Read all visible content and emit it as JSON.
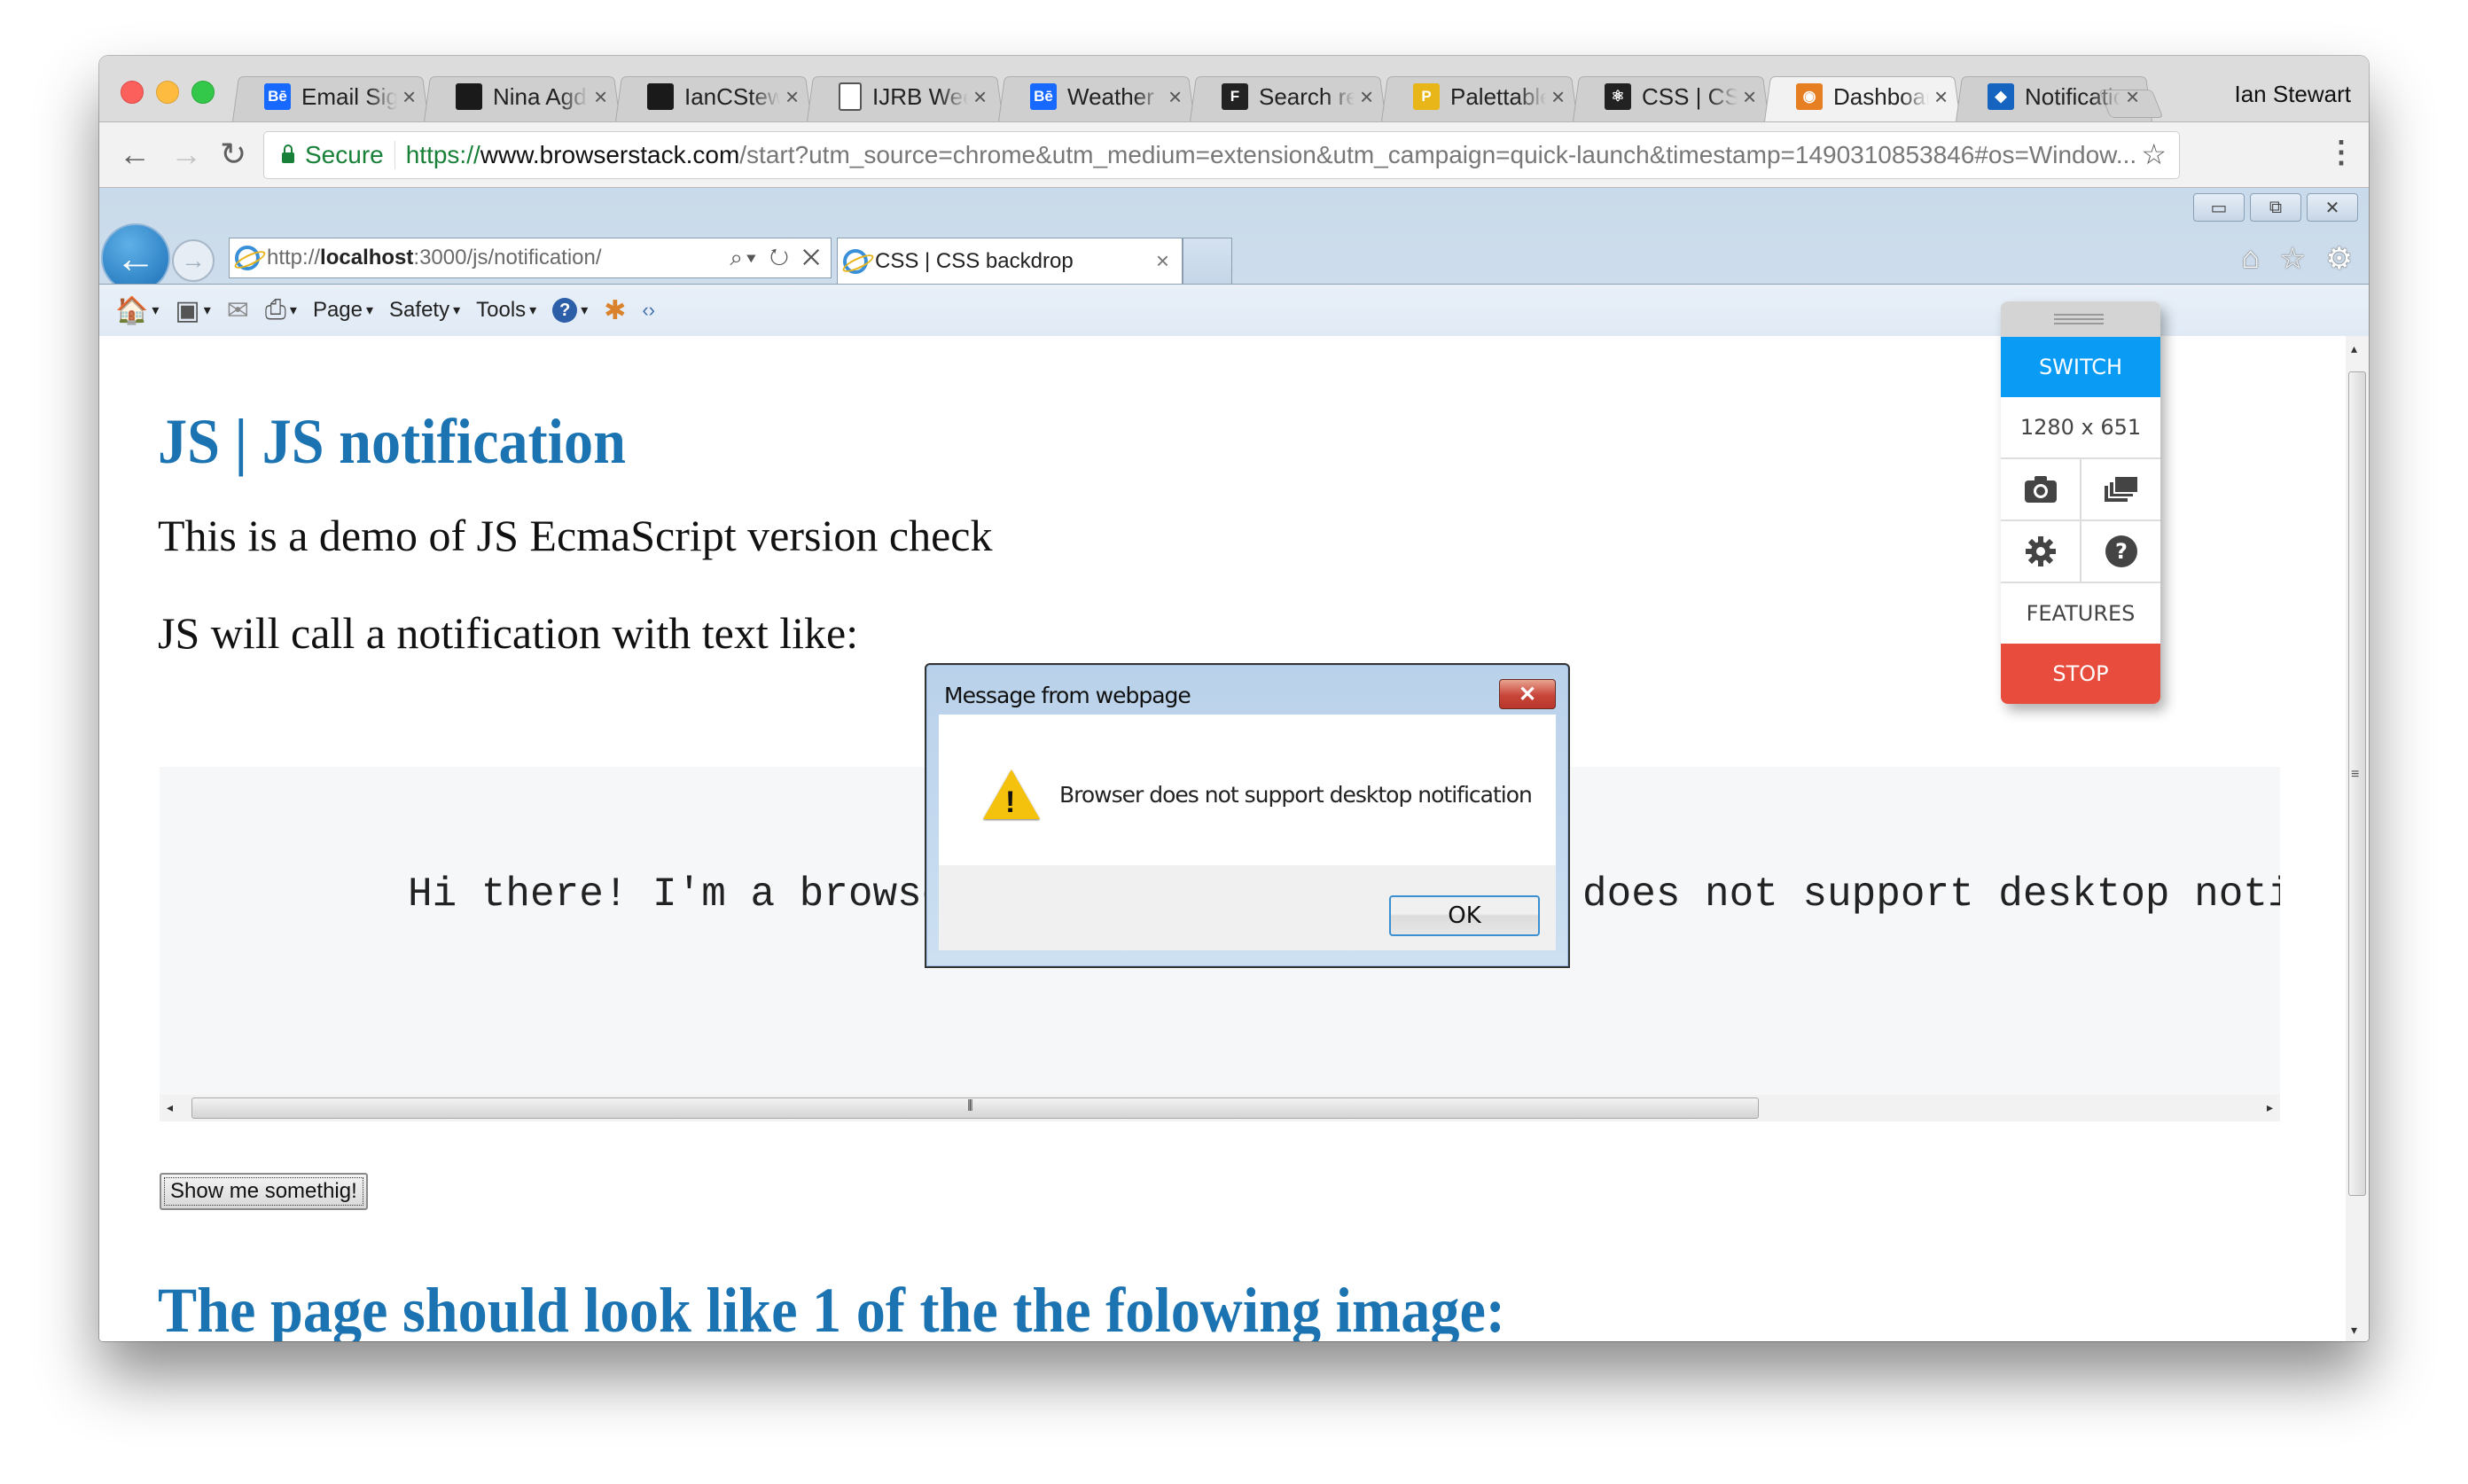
{
  "chrome": {
    "tabs": [
      {
        "title": "Email Signature",
        "icon": "behance-icon",
        "icon_text": "Bē",
        "icon_color": "#1769ff"
      },
      {
        "title": "Nina Agdal",
        "icon": "nina-agdal-icon",
        "icon_text": "",
        "icon_color": "#1a1a1a"
      },
      {
        "title": "IanCStewart",
        "icon": "github-icon",
        "icon_text": "",
        "icon_color": "#1a1a1a"
      },
      {
        "title": "IJRB Weekly",
        "icon": "document-icon",
        "icon_text": "",
        "icon_color": "#ffffff"
      },
      {
        "title": "Weather Icons",
        "icon": "behance-icon",
        "icon_text": "Bē",
        "icon_color": "#1769ff"
      },
      {
        "title": "Search results",
        "icon": "search-site-icon",
        "icon_text": "F",
        "icon_color": "#222222"
      },
      {
        "title": "Palettable",
        "icon": "palettable-icon",
        "icon_text": "P",
        "icon_color": "#e8b619"
      },
      {
        "title": "CSS | CSS backdrop",
        "icon": "react-icon",
        "icon_text": "⚛",
        "icon_color": "#222222"
      },
      {
        "title": "Dashboard",
        "icon": "chrome-dashboard-icon",
        "icon_text": "◉",
        "icon_color": "#e67e22",
        "active": true
      },
      {
        "title": "Notifications",
        "icon": "notification-app-icon",
        "icon_text": "◆",
        "icon_color": "#1565c0"
      }
    ],
    "tab_close": "×",
    "profile_name": "Ian Stewart",
    "secure_label": "Secure",
    "url_scheme": "https://",
    "url_host": "www.browserstack.com",
    "url_rest": "/start?utm_source=chrome&utm_medium=extension&utm_campaign=quick-launch&timestamp=1490310853846#os=Window...",
    "icons": {
      "back": "←",
      "forward": "→",
      "reload": "↻",
      "star": "☆",
      "menu": "⋮"
    }
  },
  "ie": {
    "address_scheme": "http://",
    "address_host": "localhost",
    "address_rest": ":3000/js/notification/",
    "address_icons": "⌕▾ ↻ ✕",
    "tab_title": "CSS | CSS backdrop",
    "tab_close": "×",
    "win_buttons": {
      "minimize": "▭",
      "restore": "⧉",
      "close": "✕"
    },
    "right_icons": {
      "home": "⌂",
      "favorites": "☆",
      "tools": "⚙"
    },
    "command_bar": {
      "home": "🏠",
      "feeds": "▣",
      "mail": "✉",
      "print": "⎙",
      "page": "Page",
      "safety": "Safety",
      "tools": "Tools",
      "help": "?",
      "caret": "▾"
    }
  },
  "page": {
    "title": "JS | JS notification",
    "para1": "This is a demo of JS EcmaScript version check",
    "para2": "JS will call a notification with text like:",
    "pre_text": "Hi there! I'm a browser notification || Browser does not support desktop notification",
    "button_label": "Show me somethig!",
    "subheading": "The page should look like 1 of the the folowing image:"
  },
  "dialog": {
    "title": "Message from webpage",
    "message": "Browser does not support desktop notification",
    "ok_label": "OK",
    "close_glyph": "✕",
    "warn_glyph": "!"
  },
  "browserstack": {
    "switch_label": "SWITCH",
    "resolution": "1280 x 651",
    "features_label": "FEATURES",
    "stop_label": "STOP",
    "colors": {
      "switch": "#0a9bf5",
      "stop": "#e84c3d"
    }
  }
}
